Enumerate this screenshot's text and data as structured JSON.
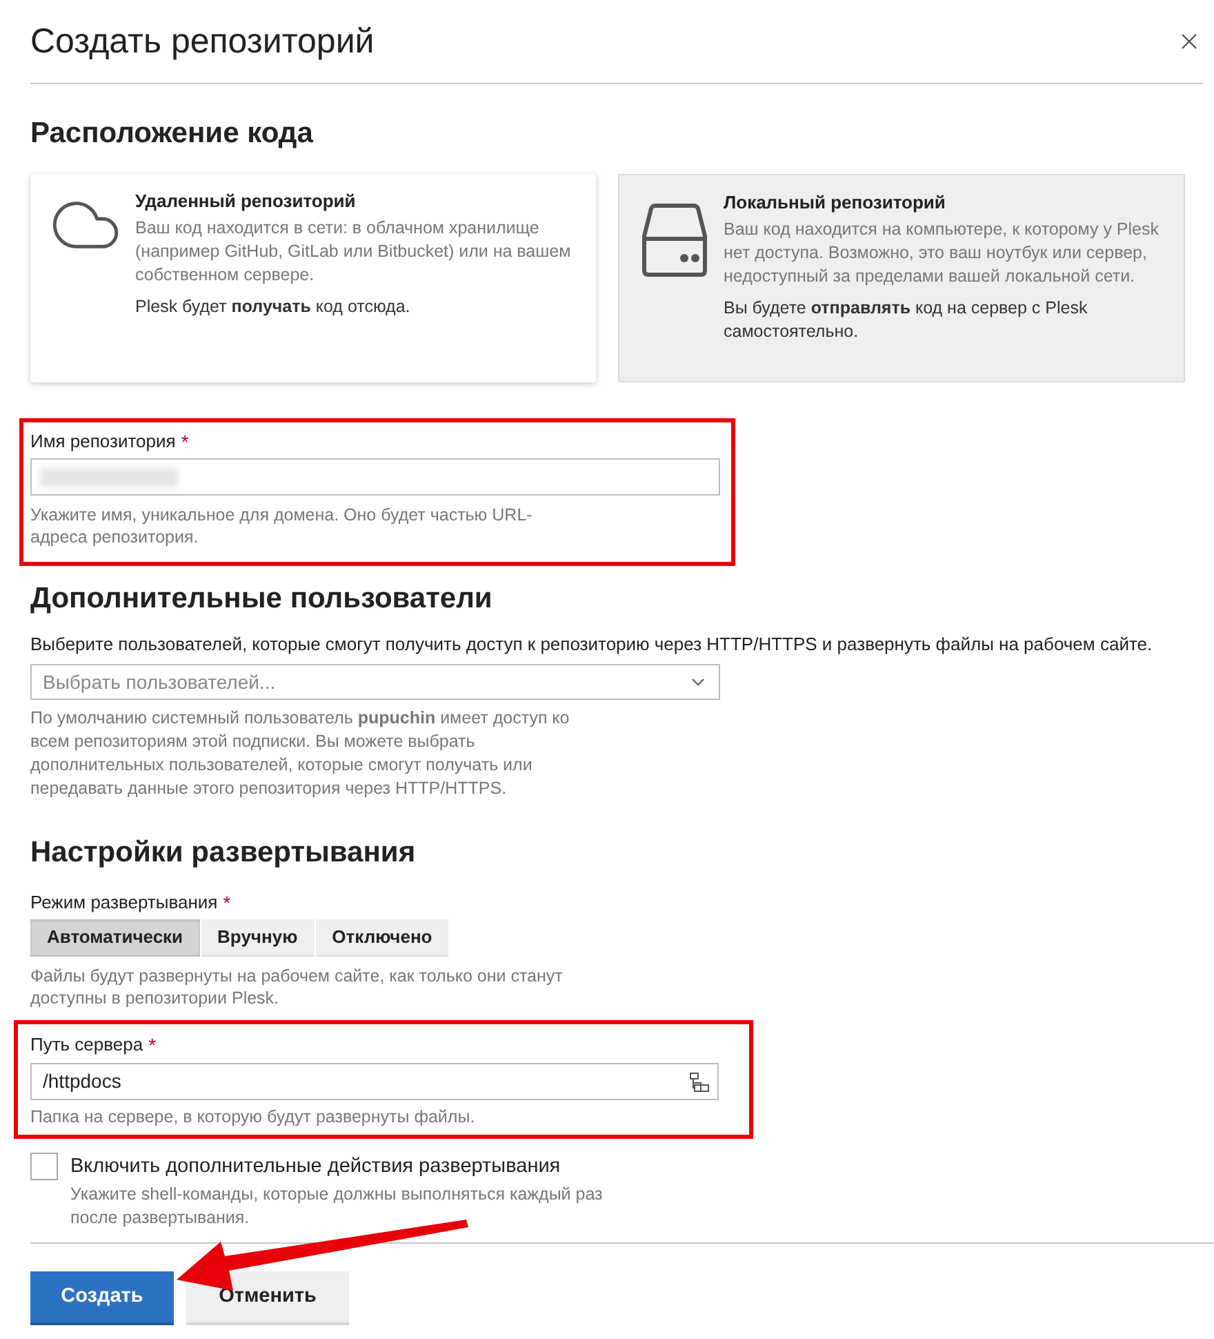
{
  "dialog": {
    "title": "Создать репозиторий"
  },
  "code_location": {
    "heading": "Расположение кода",
    "options": [
      {
        "kind": "remote",
        "title": "Удаленный репозиторий",
        "description": "Ваш код находится в сети: в облачном хранилище (например GitHub, GitLab или Bitbucket) или на вашем собственном сервере.",
        "note": "Plesk будет **получать** код отсюда.",
        "selected": false
      },
      {
        "kind": "local",
        "title": "Локальный репозиторий",
        "description": "Ваш код находится на компьютере, к которому у Plesk нет доступа. Возможно, это ваш ноутбук или сервер, недоступный за пределами вашей локальной сети.",
        "note": "Вы будете **отправлять** код на сервер с Plesk самостоятельно.",
        "selected": true
      }
    ]
  },
  "repository_name": {
    "label": "Имя репозитория",
    "required_mark": "*",
    "value_blurred": true,
    "hint": "Укажите имя, уникальное для домена. Оно будет частью URL-адреса репозитория.",
    "highlighted": true
  },
  "additional_users": {
    "heading": "Дополнительные пользователи",
    "description": "Выберите пользователей, которые смогут получить доступ к репозиторию через HTTP/HTTPS и развернуть файлы на рабочем сайте.",
    "select": {
      "placeholder": "Выбрать пользователей..."
    },
    "hint": "По умолчанию системный пользователь **pupuchin** имеет доступ ко всем репозиториям этой подписки. Вы можете выбрать дополнительных пользователей, которые смогут получать или передавать данные этого репозитория через HTTP/HTTPS."
  },
  "deployment": {
    "heading": "Настройки развертывания",
    "mode": {
      "label": "Режим развертывания",
      "required_mark": "*",
      "options": [
        {
          "label": "Автоматически",
          "selected": true
        },
        {
          "label": "Вручную",
          "selected": false
        },
        {
          "label": "Отключено",
          "selected": false
        }
      ],
      "hint": "Файлы будут развернуты на рабочем сайте, как только они станут доступны в репозитории Plesk."
    },
    "server_path": {
      "label": "Путь сервера",
      "required_mark": "*",
      "value": "/httpdocs",
      "hint": "Папка на сервере, в которую будут развернуты файлы.",
      "highlighted": true
    },
    "extra_actions": {
      "label": "Включить дополнительные действия развертывания",
      "checked": false,
      "hint": "Укажите shell-команды, которые должны выполняться каждый раз после развертывания."
    }
  },
  "buttons": [
    {
      "label": "Создать",
      "kind": "primary"
    },
    {
      "label": "Отменить",
      "kind": "secondary"
    }
  ],
  "pointer_arrow": true
}
